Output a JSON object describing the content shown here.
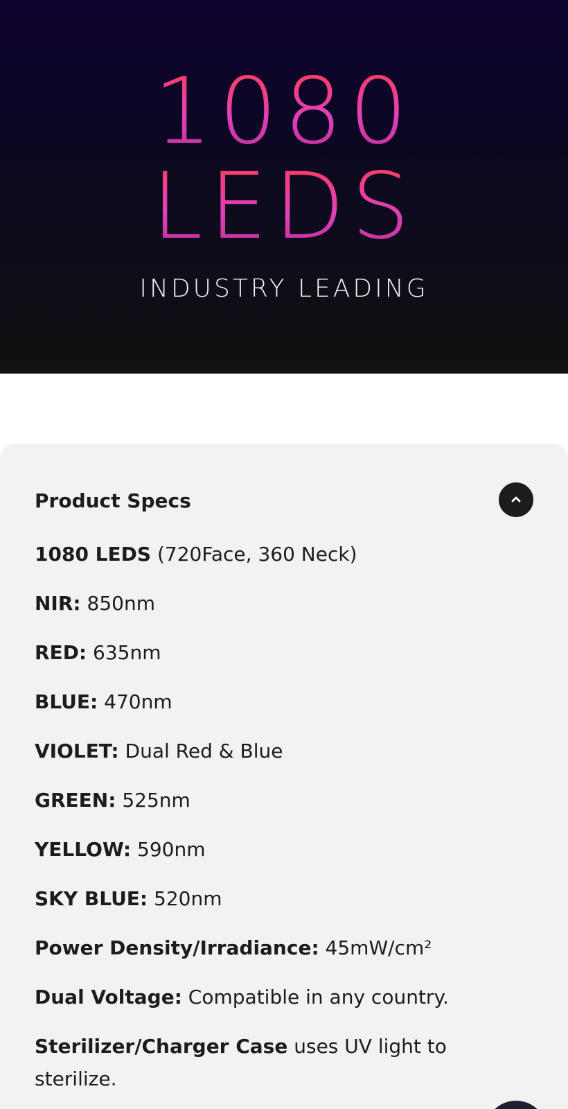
{
  "hero": {
    "number": "1080",
    "word": "LEDS",
    "subtitle": "INDUSTRY LEADING"
  },
  "specs": {
    "title": "Product Specs",
    "toggle_icon": "chevron-up-icon",
    "items": [
      {
        "label": "1080 LEDS",
        "value": " (720Face, 360 Neck)"
      },
      {
        "label": "NIR:",
        "value": " 850nm"
      },
      {
        "label": "RED:",
        "value": " 635nm"
      },
      {
        "label": "BLUE:",
        "value": " 470nm"
      },
      {
        "label": "VIOLET:",
        "value": " Dual Red & Blue"
      },
      {
        "label": "GREEN:",
        "value": " 525nm"
      },
      {
        "label": "YELLOW:",
        "value": " 590nm"
      },
      {
        "label": "SKY BLUE:",
        "value": " 520nm"
      },
      {
        "label": "Power Density/Irradiance:",
        "value": " 45mW/cm²"
      },
      {
        "label": "Dual Voltage:",
        "value": " Compatible in any country."
      },
      {
        "label": "Sterilizer/Charger Case",
        "value": " uses UV light to sterilize."
      }
    ]
  },
  "colors": {
    "hero_gradient_top": "#0e0330",
    "accent_pink": "#e040b8",
    "accent_red": "#ff3c5c",
    "card_bg": "#f2f2f2"
  }
}
